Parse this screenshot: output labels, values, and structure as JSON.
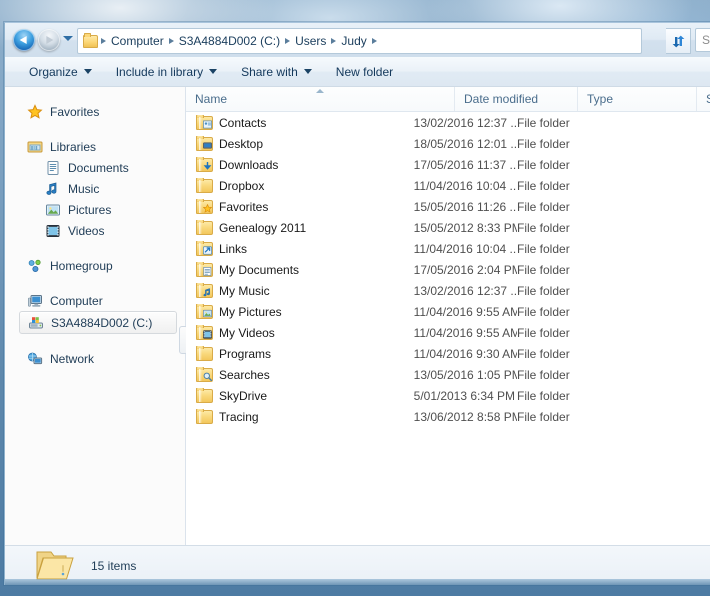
{
  "window": {
    "search_placeholder": "Se"
  },
  "addressbar": {
    "back_tooltip": "Back",
    "forward_tooltip": "Forward",
    "breadcrumbs": [
      "Computer",
      "S3A4884D002 (C:)",
      "Users",
      "Judy"
    ],
    "refresh_label": "Refresh"
  },
  "commandbar": {
    "buttons": [
      {
        "label": "Organize",
        "caret": true
      },
      {
        "label": "Include in library",
        "caret": true
      },
      {
        "label": "Share with",
        "caret": true
      },
      {
        "label": "New folder",
        "caret": false
      }
    ]
  },
  "navigation": {
    "groups": [
      {
        "items": [
          {
            "label": "Favorites",
            "icon": "star-icon",
            "level": 0,
            "selected": false
          }
        ]
      },
      {
        "items": [
          {
            "label": "Libraries",
            "icon": "libraries-icon",
            "level": 0,
            "selected": false
          },
          {
            "label": "Documents",
            "icon": "documents-icon",
            "level": 1,
            "selected": false
          },
          {
            "label": "Music",
            "icon": "music-icon",
            "level": 1,
            "selected": false
          },
          {
            "label": "Pictures",
            "icon": "pictures-icon",
            "level": 1,
            "selected": false
          },
          {
            "label": "Videos",
            "icon": "videos-icon",
            "level": 1,
            "selected": false
          }
        ]
      },
      {
        "items": [
          {
            "label": "Homegroup",
            "icon": "homegroup-icon",
            "level": 0,
            "selected": false
          }
        ]
      },
      {
        "items": [
          {
            "label": "Computer",
            "icon": "computer-icon",
            "level": 0,
            "selected": false
          },
          {
            "label": "S3A4884D002 (C:)",
            "icon": "harddrive-icon",
            "level": 1,
            "selected": true
          }
        ]
      },
      {
        "items": [
          {
            "label": "Network",
            "icon": "network-icon",
            "level": 0,
            "selected": false
          }
        ]
      }
    ]
  },
  "filelist": {
    "columns": [
      {
        "label": "Name",
        "sorted": "asc"
      },
      {
        "label": "Date modified",
        "sorted": null
      },
      {
        "label": "Type",
        "sorted": null
      },
      {
        "label": "Size",
        "sorted": null
      }
    ],
    "rows": [
      {
        "name": "Contacts",
        "icon": "folder-contacts-icon",
        "date": "13/02/2016 12:37 ...",
        "type": "File folder",
        "size": ""
      },
      {
        "name": "Desktop",
        "icon": "folder-desktop-icon",
        "date": "18/05/2016 12:01 ...",
        "type": "File folder",
        "size": ""
      },
      {
        "name": "Downloads",
        "icon": "folder-downloads-icon",
        "date": "17/05/2016 11:37 ...",
        "type": "File folder",
        "size": ""
      },
      {
        "name": "Dropbox",
        "icon": "folder-icon",
        "date": "11/04/2016 10:04 ...",
        "type": "File folder",
        "size": ""
      },
      {
        "name": "Favorites",
        "icon": "folder-favorites-icon",
        "date": "15/05/2016 11:26 ...",
        "type": "File folder",
        "size": ""
      },
      {
        "name": "Genealogy 2011",
        "icon": "folder-icon",
        "date": "15/05/2012 8:33 PM",
        "type": "File folder",
        "size": ""
      },
      {
        "name": "Links",
        "icon": "folder-links-icon",
        "date": "11/04/2016 10:04 ...",
        "type": "File folder",
        "size": ""
      },
      {
        "name": "My Documents",
        "icon": "folder-documents-icon",
        "date": "17/05/2016 2:04 PM",
        "type": "File folder",
        "size": ""
      },
      {
        "name": "My Music",
        "icon": "folder-music-icon",
        "date": "13/02/2016 12:37 ...",
        "type": "File folder",
        "size": ""
      },
      {
        "name": "My Pictures",
        "icon": "folder-pictures-icon",
        "date": "11/04/2016 9:55 AM",
        "type": "File folder",
        "size": ""
      },
      {
        "name": "My Videos",
        "icon": "folder-videos-icon",
        "date": "11/04/2016 9:55 AM",
        "type": "File folder",
        "size": ""
      },
      {
        "name": "Programs",
        "icon": "folder-icon",
        "date": "11/04/2016 9:30 AM",
        "type": "File folder",
        "size": ""
      },
      {
        "name": "Searches",
        "icon": "folder-searches-icon",
        "date": "13/05/2016 1:05 PM",
        "type": "File folder",
        "size": ""
      },
      {
        "name": "SkyDrive",
        "icon": "folder-icon",
        "date": "5/01/2013 6:34 PM",
        "type": "File folder",
        "size": ""
      },
      {
        "name": "Tracing",
        "icon": "folder-icon",
        "date": "13/06/2012 8:58 PM",
        "type": "File folder",
        "size": ""
      }
    ]
  },
  "statusbar": {
    "icon": "open-folder-icon",
    "text": "15 items"
  }
}
